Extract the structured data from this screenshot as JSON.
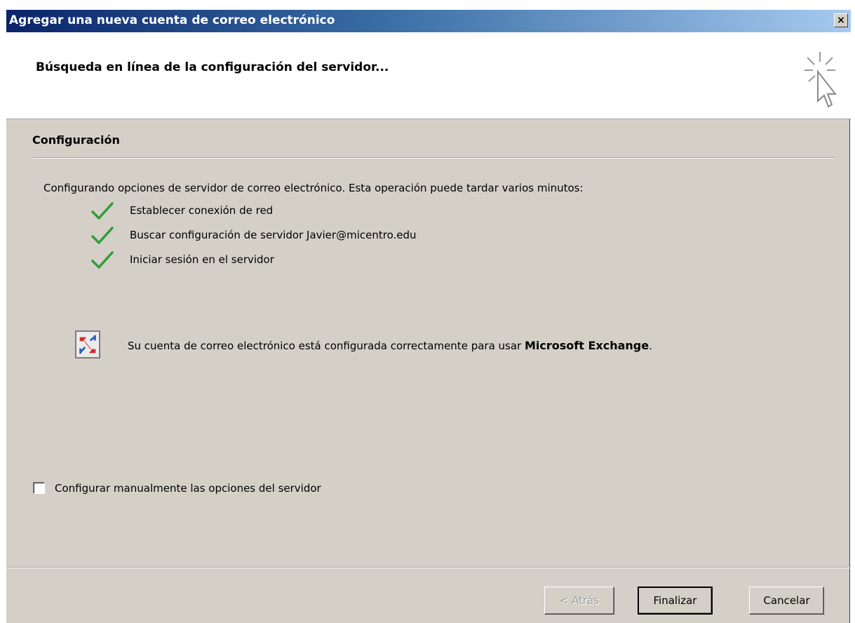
{
  "window": {
    "title": "Agregar una nueva cuenta de correo electrónico",
    "close_label": "×"
  },
  "header": {
    "title": "Búsqueda en línea de la configuración del servidor...",
    "icon": "wizard-cursor-icon"
  },
  "configuration": {
    "section_title": "Configuración",
    "intro": "Configurando opciones de servidor de correo electrónico. Esta operación puede tardar varios minutos:",
    "steps": [
      {
        "label": "Establecer conexión de red",
        "status": "done",
        "icon": "checkmark-icon"
      },
      {
        "label": "Buscar configuración de servidor Javier@micentro.edu",
        "status": "done",
        "icon": "checkmark-icon"
      },
      {
        "label": "Iniciar sesión en el servidor",
        "status": "done",
        "icon": "checkmark-icon"
      }
    ],
    "result": {
      "icon": "exchange-icon",
      "text": "Su cuenta de correo electrónico está configurada correctamente para usar ",
      "product": "Microsoft Exchange",
      "suffix": "."
    },
    "manual_checkbox": {
      "label": "Configurar manualmente las opciones del servidor",
      "checked": false
    }
  },
  "buttons": {
    "back": "< Atrás",
    "finish": "Finalizar",
    "cancel": "Cancelar"
  },
  "colors": {
    "check": "#2f9e3a",
    "dialog_bg": "#d4d0c8",
    "title_bar_start": "#0a246a",
    "title_bar_end": "#a6caf0"
  }
}
